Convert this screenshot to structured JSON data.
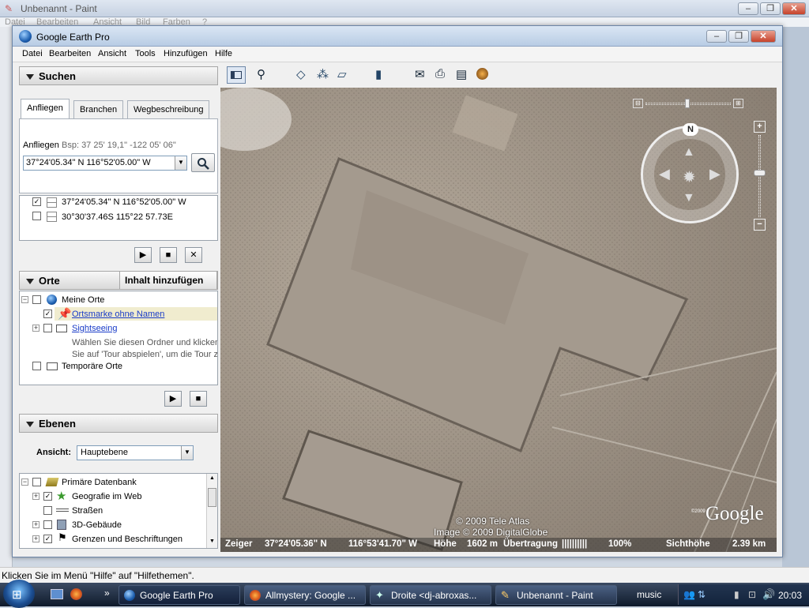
{
  "paint": {
    "title": "Unbenannt - Paint",
    "menu": [
      "Datei",
      "Bearbeiten",
      "Ansicht",
      "Bild",
      "Farben",
      "?"
    ],
    "status": "Klicken Sie im Menü \"Hilfe\" auf \"Hilfethemen\"."
  },
  "ge": {
    "title": "Google Earth Pro",
    "menu": [
      "Datei",
      "Bearbeiten",
      "Ansicht",
      "Tools",
      "Hinzufügen",
      "Hilfe"
    ]
  },
  "search": {
    "header": "Suchen",
    "tabs": [
      "Anfliegen",
      "Branchen",
      "Wegbeschreibung"
    ],
    "label": "Anfliegen",
    "hint": "Bsp: 37 25' 19,1\" -122 05' 06\"",
    "value": "37°24'05.34\" N 116°52'05.00\" W",
    "results": [
      "37°24'05.34\" N 116°52'05.00\" W",
      "30°30'37.46S 115°22 57.73E"
    ]
  },
  "places": {
    "header": "Orte",
    "add_button": "Inhalt hinzufügen",
    "items": {
      "my_places": "Meine Orte",
      "placemark": "Ortsmarke ohne Namen",
      "sightseeing": "Sightseeing",
      "desc1": "Wählen Sie diesen Ordner und klicken",
      "desc2": "Sie auf 'Tour abspielen', um die Tour z",
      "temp": "Temporäre Orte"
    }
  },
  "layers": {
    "header": "Ebenen",
    "view_label": "Ansicht:",
    "view_value": "Hauptebene",
    "items": [
      "Primäre Datenbank",
      "Geografie im Web",
      "Straßen",
      "3D-Gebäude",
      "Grenzen und Beschriftungen"
    ]
  },
  "nav": {
    "north": "N"
  },
  "map": {
    "copyright1": "© 2009 Tele Atlas",
    "copyright2": "Image © 2009 DigitalGlobe",
    "logo": "Google",
    "logo_small": "©2009",
    "status": {
      "pointer_label": "Zeiger",
      "lat": "37°24'05.36\" N",
      "lon": "116°53'41.70\" W",
      "elev_label": "Höhe",
      "elev": "1602 m",
      "stream_label": "Übertragung",
      "stream_bars": "||||||||||",
      "stream_pct": "100%",
      "eye_label": "Sichthöhe",
      "eye": "2.39 km"
    }
  },
  "taskbar": {
    "tasks": [
      "Google Earth Pro",
      "Allmystery: Google ...",
      "Droite <dj-abroxas...",
      "Unbenannt - Paint"
    ],
    "music": "music",
    "time": "20:03"
  }
}
